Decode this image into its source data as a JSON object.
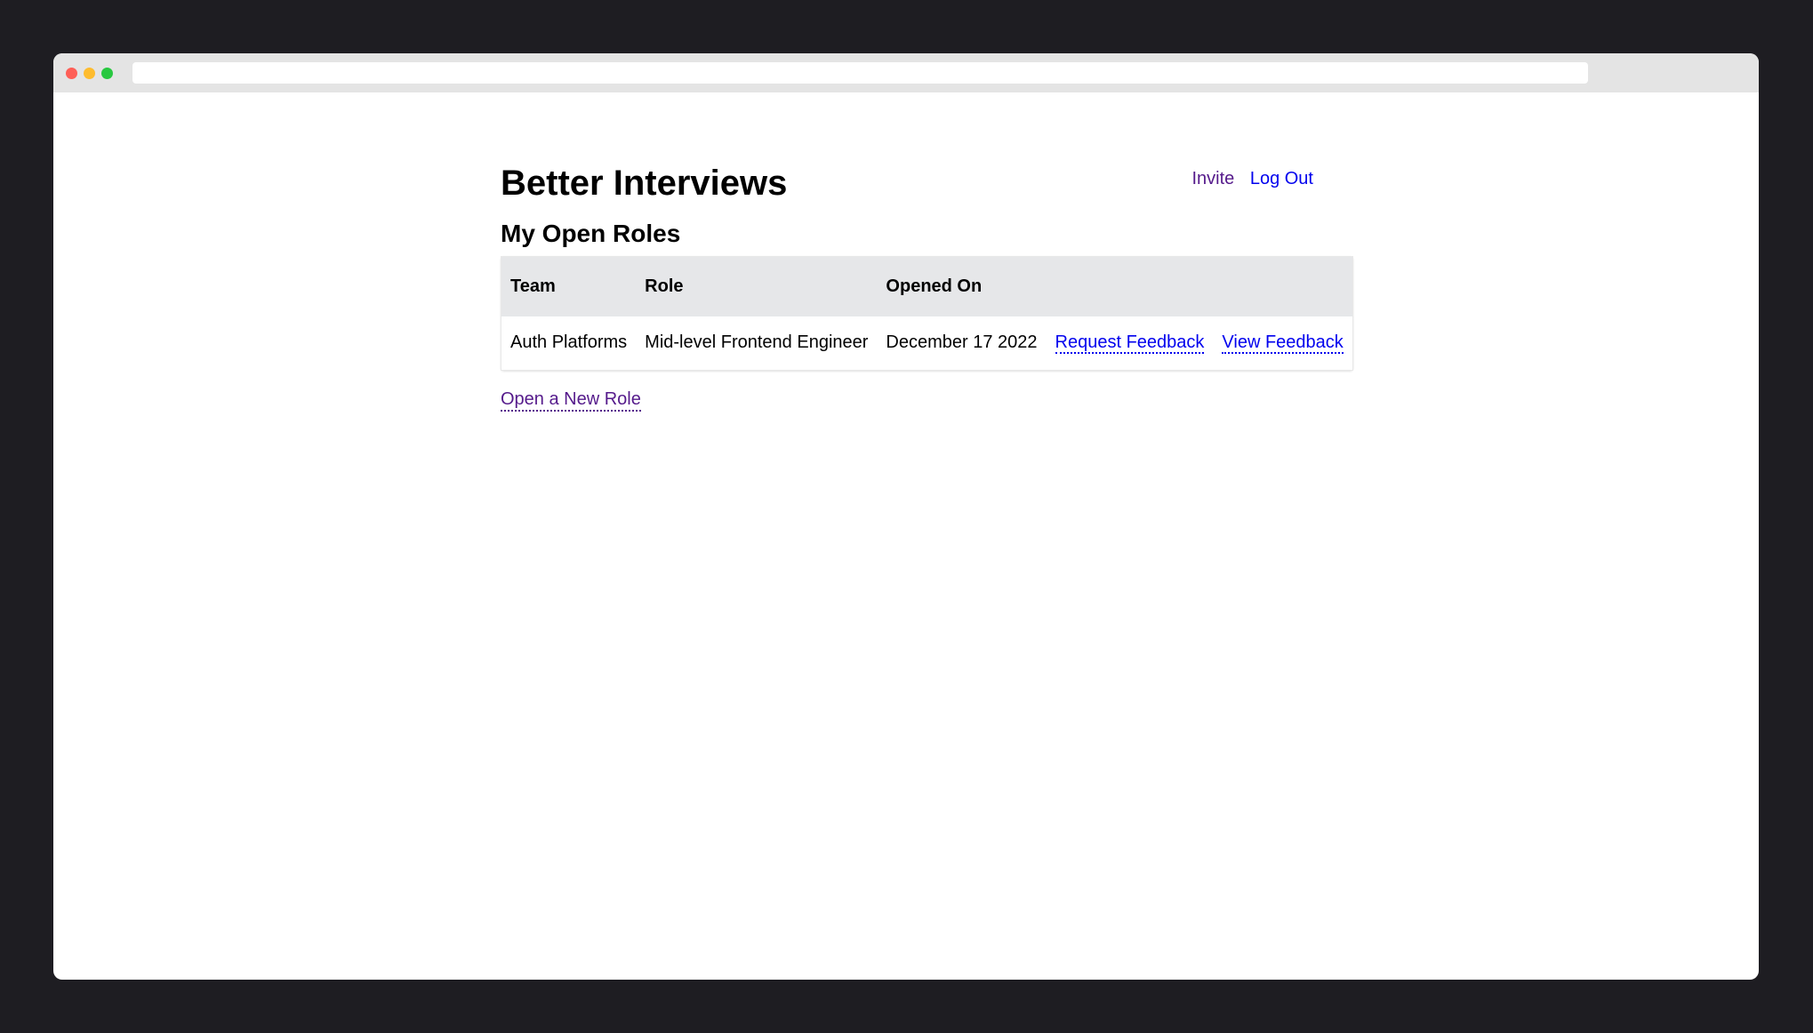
{
  "app": {
    "title": "Better Interviews"
  },
  "nav": {
    "invite_label": "Invite",
    "logout_label": "Log Out"
  },
  "main": {
    "section_title": "My Open Roles",
    "table": {
      "headers": [
        "Team",
        "Role",
        "Opened On",
        "",
        ""
      ],
      "rows": [
        {
          "team": "Auth Platforms",
          "role": "Mid-level Frontend Engineer",
          "opened_on": "December 17 2022",
          "request_feedback_label": "Request Feedback",
          "view_feedback_label": "View Feedback"
        }
      ]
    },
    "open_new_role_label": "Open a New Role"
  },
  "colors": {
    "link": "#0000ee",
    "visited_link": "#551a8b",
    "table_header_bg": "#e6e7e9",
    "outer_bg": "#1e1d22"
  }
}
